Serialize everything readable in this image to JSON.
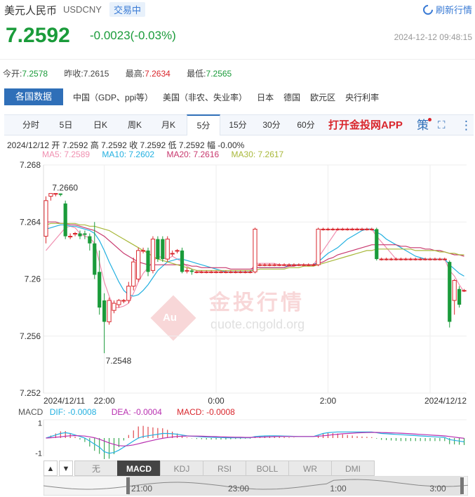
{
  "header": {
    "title": "美元人民币",
    "code": "USDCNY",
    "status": "交易中",
    "refresh": "刷新行情",
    "price": "7.2592",
    "change": "-0.0023(-0.03%)",
    "timestamp": "2024-12-12 09:48:15"
  },
  "stats": {
    "open_label": "今开:",
    "open": "7.2578",
    "prev_label": "昨收:",
    "prev": "7.2615",
    "high_label": "最高:",
    "high": "7.2634",
    "low_label": "最低:",
    "low": "7.2565"
  },
  "nav": {
    "active": "各国数据",
    "items": [
      "中国（GDP、ppi等）",
      "美国（非农、失业率）",
      "日本",
      "德国",
      "欧元区",
      "央行利率"
    ]
  },
  "tabs": [
    "分时",
    "5日",
    "日K",
    "周K",
    "月K",
    "5分",
    "15分",
    "30分",
    "60分"
  ],
  "selected_tab": "5分",
  "app_label": "打开金投网APP",
  "strategy_label": "策",
  "info": {
    "date": "2024/12/12",
    "open": "开 7.2592",
    "high": "高 7.2592",
    "close": "收 7.2592",
    "low": "低 7.2592",
    "amp": "幅 -0.00%"
  },
  "ma": {
    "ma5": "MA5: 7.2589",
    "ma10": "MA10: 7.2602",
    "ma20": "MA20: 7.2616",
    "ma30": "MA30: 7.2617"
  },
  "macd_info": {
    "label": "MACD",
    "dif": "DIF: -0.0008",
    "dea": "DEA: -0.0004",
    "macd": "MACD: -0.0008"
  },
  "watermark": {
    "brand": "金投行情",
    "url": "quote.cngold.org",
    "badge": "Au"
  },
  "bottom_tabs": [
    "无",
    "MACD",
    "KDJ",
    "RSI",
    "BOLL",
    "WR",
    "DMI"
  ],
  "bottom_selected": "MACD",
  "arrows": {
    "up": "▲",
    "down": "▼"
  },
  "colors": {
    "up": "#d9262c",
    "down": "#1a9b3a",
    "ma5": "#f08fb0",
    "ma10": "#22b0e0",
    "ma20": "#c8386e",
    "ma30": "#a8b83a",
    "dif": "#22b0e0",
    "dea": "#b82fb0",
    "accent": "#2f6fb8"
  },
  "chart_data": {
    "type": "candlestick",
    "ylim": [
      7.252,
      7.268
    ],
    "yticks": [
      "7.268",
      "7.264",
      "7.26",
      "7.256",
      "7.252"
    ],
    "x_labels": [
      "2024/12/11",
      "22:00",
      "0:00",
      "2:00",
      "2024/12/12"
    ],
    "annotations": {
      "max": "7.2660",
      "min": "7.2548"
    },
    "candles": [
      {
        "o": 7.263,
        "c": 7.2655,
        "h": 7.2658,
        "l": 7.2625
      },
      {
        "o": 7.2658,
        "c": 7.266,
        "h": 7.266,
        "l": 7.2655
      },
      {
        "o": 7.266,
        "c": 7.266,
        "h": 7.266,
        "l": 7.2658
      },
      {
        "o": 7.266,
        "c": 7.2659,
        "h": 7.266,
        "l": 7.2658
      },
      {
        "o": 7.2653,
        "c": 7.263,
        "h": 7.2655,
        "l": 7.2628
      },
      {
        "o": 7.263,
        "c": 7.263,
        "h": 7.2632,
        "l": 7.2628
      },
      {
        "o": 7.2632,
        "c": 7.2632,
        "h": 7.2633,
        "l": 7.263
      },
      {
        "o": 7.2632,
        "c": 7.263,
        "h": 7.2634,
        "l": 7.2628
      },
      {
        "o": 7.2632,
        "c": 7.2631,
        "h": 7.2634,
        "l": 7.2628
      },
      {
        "o": 7.263,
        "c": 7.2625,
        "h": 7.2632,
        "l": 7.262
      },
      {
        "o": 7.2625,
        "c": 7.2603,
        "h": 7.264,
        "l": 7.26
      },
      {
        "o": 7.2605,
        "c": 7.258,
        "h": 7.262,
        "l": 7.2575
      },
      {
        "o": 7.2585,
        "c": 7.257,
        "h": 7.259,
        "l": 7.2548
      },
      {
        "o": 7.257,
        "c": 7.2585,
        "h": 7.2587,
        "l": 7.2568
      },
      {
        "o": 7.2578,
        "c": 7.2583,
        "h": 7.2585,
        "l": 7.2576
      },
      {
        "o": 7.2582,
        "c": 7.2585,
        "h": 7.2586,
        "l": 7.258
      },
      {
        "o": 7.2585,
        "c": 7.2585,
        "h": 7.2586,
        "l": 7.2583
      },
      {
        "o": 7.2585,
        "c": 7.2595,
        "h": 7.2598,
        "l": 7.2583
      },
      {
        "o": 7.2595,
        "c": 7.2612,
        "h": 7.2615,
        "l": 7.2592
      },
      {
        "o": 7.26,
        "c": 7.262,
        "h": 7.2622,
        "l": 7.2598
      },
      {
        "o": 7.262,
        "c": 7.262,
        "h": 7.2622,
        "l": 7.2618
      },
      {
        "o": 7.262,
        "c": 7.2605,
        "h": 7.2622,
        "l": 7.2602
      },
      {
        "o": 7.2606,
        "c": 7.2628,
        "h": 7.263,
        "l": 7.2604
      },
      {
        "o": 7.2628,
        "c": 7.2614,
        "h": 7.263,
        "l": 7.2612
      },
      {
        "o": 7.2628,
        "c": 7.2614,
        "h": 7.263,
        "l": 7.2612
      },
      {
        "o": 7.2614,
        "c": 7.2628,
        "h": 7.263,
        "l": 7.2612
      },
      {
        "o": 7.2618,
        "c": 7.2618,
        "h": 7.262,
        "l": 7.2616
      },
      {
        "o": 7.262,
        "c": 7.262,
        "h": 7.2621,
        "l": 7.2618
      },
      {
        "o": 7.262,
        "c": 7.2605,
        "h": 7.2622,
        "l": 7.2604
      },
      {
        "o": 7.2606,
        "c": 7.2606,
        "h": 7.2608,
        "l": 7.2604
      },
      {
        "o": 7.2606,
        "c": 7.2605,
        "h": 7.2607,
        "l": 7.2603
      },
      {
        "o": 7.2605,
        "c": 7.2605,
        "h": 7.2606,
        "l": 7.2604
      },
      {
        "o": 7.2605,
        "c": 7.2605,
        "h": 7.2606,
        "l": 7.2604
      },
      {
        "o": 7.2605,
        "c": 7.2605,
        "h": 7.2606,
        "l": 7.2604
      },
      {
        "o": 7.2605,
        "c": 7.2605,
        "h": 7.2606,
        "l": 7.2604
      },
      {
        "o": 7.2605,
        "c": 7.2605,
        "h": 7.2606,
        "l": 7.2604
      },
      {
        "o": 7.2605,
        "c": 7.2605,
        "h": 7.2606,
        "l": 7.2604
      },
      {
        "o": 7.2605,
        "c": 7.2605,
        "h": 7.2606,
        "l": 7.2604
      },
      {
        "o": 7.2605,
        "c": 7.2605,
        "h": 7.2606,
        "l": 7.2604
      },
      {
        "o": 7.2605,
        "c": 7.2605,
        "h": 7.2606,
        "l": 7.2604
      },
      {
        "o": 7.2605,
        "c": 7.2605,
        "h": 7.2606,
        "l": 7.2604
      },
      {
        "o": 7.2605,
        "c": 7.2605,
        "h": 7.2606,
        "l": 7.2604
      },
      {
        "o": 7.2605,
        "c": 7.2605,
        "h": 7.2606,
        "l": 7.2604
      },
      {
        "o": 7.2605,
        "c": 7.2635,
        "h": 7.2636,
        "l": 7.2604
      },
      {
        "o": 7.261,
        "c": 7.261,
        "h": 7.2611,
        "l": 7.2609
      },
      {
        "o": 7.261,
        "c": 7.261,
        "h": 7.2611,
        "l": 7.2609
      },
      {
        "o": 7.261,
        "c": 7.261,
        "h": 7.2611,
        "l": 7.2609
      },
      {
        "o": 7.261,
        "c": 7.261,
        "h": 7.2611,
        "l": 7.2609
      },
      {
        "o": 7.261,
        "c": 7.261,
        "h": 7.2611,
        "l": 7.2609
      },
      {
        "o": 7.261,
        "c": 7.261,
        "h": 7.2611,
        "l": 7.2609
      },
      {
        "o": 7.261,
        "c": 7.261,
        "h": 7.2611,
        "l": 7.2609
      },
      {
        "o": 7.261,
        "c": 7.261,
        "h": 7.2611,
        "l": 7.2609
      },
      {
        "o": 7.261,
        "c": 7.261,
        "h": 7.2611,
        "l": 7.2609
      },
      {
        "o": 7.261,
        "c": 7.261,
        "h": 7.2611,
        "l": 7.2609
      },
      {
        "o": 7.261,
        "c": 7.261,
        "h": 7.2611,
        "l": 7.2609
      },
      {
        "o": 7.261,
        "c": 7.261,
        "h": 7.2611,
        "l": 7.2609
      },
      {
        "o": 7.261,
        "c": 7.2635,
        "h": 7.2636,
        "l": 7.2609
      },
      {
        "o": 7.2635,
        "c": 7.2635,
        "h": 7.2636,
        "l": 7.2634
      },
      {
        "o": 7.2635,
        "c": 7.2635,
        "h": 7.2636,
        "l": 7.2634
      },
      {
        "o": 7.2635,
        "c": 7.2635,
        "h": 7.2636,
        "l": 7.2634
      },
      {
        "o": 7.2635,
        "c": 7.2635,
        "h": 7.2636,
        "l": 7.2634
      },
      {
        "o": 7.2635,
        "c": 7.2635,
        "h": 7.2636,
        "l": 7.2634
      },
      {
        "o": 7.2635,
        "c": 7.2635,
        "h": 7.2636,
        "l": 7.2634
      },
      {
        "o": 7.2635,
        "c": 7.2635,
        "h": 7.2636,
        "l": 7.2634
      },
      {
        "o": 7.2635,
        "c": 7.2635,
        "h": 7.2636,
        "l": 7.2634
      },
      {
        "o": 7.2635,
        "c": 7.2635,
        "h": 7.2636,
        "l": 7.2634
      },
      {
        "o": 7.2635,
        "c": 7.2635,
        "h": 7.2636,
        "l": 7.2634
      },
      {
        "o": 7.2635,
        "c": 7.2635,
        "h": 7.2636,
        "l": 7.2634
      },
      {
        "o": 7.2635,
        "c": 7.2614,
        "h": 7.2636,
        "l": 7.2613
      },
      {
        "o": 7.2614,
        "c": 7.2614,
        "h": 7.2615,
        "l": 7.2613
      },
      {
        "o": 7.2614,
        "c": 7.2614,
        "h": 7.2615,
        "l": 7.2613
      },
      {
        "o": 7.2614,
        "c": 7.2614,
        "h": 7.2615,
        "l": 7.2613
      },
      {
        "o": 7.2614,
        "c": 7.2614,
        "h": 7.2615,
        "l": 7.2613
      },
      {
        "o": 7.2614,
        "c": 7.2614,
        "h": 7.2615,
        "l": 7.2613
      },
      {
        "o": 7.2614,
        "c": 7.2614,
        "h": 7.2615,
        "l": 7.2613
      },
      {
        "o": 7.2614,
        "c": 7.2614,
        "h": 7.2615,
        "l": 7.2613
      },
      {
        "o": 7.2614,
        "c": 7.2614,
        "h": 7.2615,
        "l": 7.2613
      },
      {
        "o": 7.2614,
        "c": 7.2614,
        "h": 7.2615,
        "l": 7.2613
      },
      {
        "o": 7.2614,
        "c": 7.2614,
        "h": 7.2615,
        "l": 7.2613
      },
      {
        "o": 7.2614,
        "c": 7.2614,
        "h": 7.2615,
        "l": 7.2613
      },
      {
        "o": 7.2614,
        "c": 7.2614,
        "h": 7.2615,
        "l": 7.2613
      },
      {
        "o": 7.2614,
        "c": 7.2614,
        "h": 7.2615,
        "l": 7.2613
      },
      {
        "o": 7.2614,
        "c": 7.2614,
        "h": 7.2615,
        "l": 7.2613
      },
      {
        "o": 7.2612,
        "c": 7.257,
        "h": 7.2613,
        "l": 7.2566
      },
      {
        "o": 7.2585,
        "c": 7.2599,
        "h": 7.26,
        "l": 7.2575
      },
      {
        "o": 7.2593,
        "c": 7.2582,
        "h": 7.2595,
        "l": 7.258
      },
      {
        "o": 7.2592,
        "c": 7.2592,
        "h": 7.2593,
        "l": 7.2591
      }
    ],
    "ma_series": [
      {
        "name": "MA5",
        "values": [
          7.262,
          7.2624,
          7.2628,
          7.2632,
          7.2636,
          7.2637,
          7.2636,
          7.2632,
          7.263,
          7.2629,
          7.2625,
          7.2612,
          7.2598,
          7.2588,
          7.258,
          7.258,
          7.2581,
          7.2583,
          7.259,
          7.2598,
          7.2604,
          7.2608,
          7.2612,
          7.2616,
          7.2615,
          7.2614,
          7.2616,
          7.2614,
          7.2612,
          7.2609,
          7.2607,
          7.2606,
          7.2605,
          7.2605,
          7.2605,
          7.2605,
          7.2605,
          7.2605,
          7.2605,
          7.2605,
          7.2605,
          7.2605,
          7.2605,
          7.2611,
          7.2611,
          7.2611,
          7.2611,
          7.2611,
          7.261,
          7.261,
          7.261,
          7.261,
          7.261,
          7.261,
          7.261,
          7.261,
          7.2615,
          7.262,
          7.2625,
          7.263,
          7.2635,
          7.2635,
          7.2635,
          7.2635,
          7.2635,
          7.2635,
          7.2635,
          7.2635,
          7.263,
          7.2626,
          7.2622,
          7.2618,
          7.2614,
          7.2614,
          7.2614,
          7.2614,
          7.2614,
          7.2614,
          7.2614,
          7.2614,
          7.2614,
          7.2614,
          7.2614,
          7.2606,
          7.2602,
          7.2596,
          7.2591
        ]
      },
      {
        "name": "MA10",
        "values": [
          7.2635,
          7.2636,
          7.2637,
          7.2638,
          7.2638,
          7.2637,
          7.2637,
          7.2636,
          7.2635,
          7.2634,
          7.2632,
          7.2627,
          7.262,
          7.2612,
          7.2605,
          7.2598,
          7.2592,
          7.2589,
          7.2588,
          7.2589,
          7.2592,
          7.2596,
          7.2601,
          7.2606,
          7.2609,
          7.2612,
          7.2613,
          7.2614,
          7.2614,
          7.2613,
          7.2612,
          7.2611,
          7.261,
          7.2609,
          7.2608,
          7.2607,
          7.2606,
          7.2605,
          7.2605,
          7.2605,
          7.2605,
          7.2605,
          7.2605,
          7.2608,
          7.2608,
          7.2608,
          7.2608,
          7.2608,
          7.2608,
          7.2608,
          7.261,
          7.261,
          7.261,
          7.261,
          7.261,
          7.261,
          7.2612,
          7.2615,
          7.2618,
          7.262,
          7.2622,
          7.2625,
          7.2628,
          7.263,
          7.2632,
          7.2634,
          7.2635,
          7.2635,
          7.2633,
          7.2631,
          7.2628,
          7.2626,
          7.2624,
          7.2622,
          7.262,
          7.2618,
          7.2616,
          7.2615,
          7.2614,
          7.2614,
          7.2614,
          7.2614,
          7.2614,
          7.261,
          7.2607,
          7.2604,
          7.2602
        ]
      },
      {
        "name": "MA20",
        "values": [
          7.264,
          7.264,
          7.264,
          7.2639,
          7.2639,
          7.2638,
          7.2638,
          7.2637,
          7.2636,
          7.2635,
          7.2634,
          7.2632,
          7.263,
          7.2627,
          7.2624,
          7.2621,
          7.2618,
          7.2616,
          7.2614,
          7.2612,
          7.2611,
          7.261,
          7.261,
          7.261,
          7.261,
          7.261,
          7.261,
          7.261,
          7.261,
          7.261,
          7.2609,
          7.2609,
          7.2608,
          7.2608,
          7.2608,
          7.2608,
          7.2608,
          7.2608,
          7.2607,
          7.2607,
          7.2607,
          7.2607,
          7.2607,
          7.2608,
          7.2608,
          7.2608,
          7.2608,
          7.2608,
          7.2608,
          7.2608,
          7.2609,
          7.2609,
          7.261,
          7.261,
          7.261,
          7.261,
          7.2611,
          7.2612,
          7.2614,
          7.2615,
          7.2617,
          7.2618,
          7.2619,
          7.262,
          7.2621,
          7.2622,
          7.2623,
          7.2624,
          7.2624,
          7.2624,
          7.2624,
          7.2624,
          7.2624,
          7.2623,
          7.2623,
          7.2622,
          7.2622,
          7.2622,
          7.2621,
          7.2621,
          7.262,
          7.262,
          7.2619,
          7.2618,
          7.2617,
          7.2617,
          7.2616
        ]
      },
      {
        "name": "MA30",
        "values": [
          7.2638,
          7.2639,
          7.2639,
          7.2639,
          7.2639,
          7.2639,
          7.2639,
          7.2638,
          7.2638,
          7.2637,
          7.2637,
          7.2636,
          7.2635,
          7.2634,
          7.2632,
          7.263,
          7.2628,
          7.2626,
          7.2624,
          7.2622,
          7.262,
          7.2618,
          7.2616,
          7.2614,
          7.2613,
          7.2612,
          7.2611,
          7.261,
          7.2609,
          7.2608,
          7.2607,
          7.2606,
          7.2606,
          7.2606,
          7.2606,
          7.2606,
          7.2606,
          7.2606,
          7.2606,
          7.2606,
          7.2606,
          7.2606,
          7.2606,
          7.2606,
          7.2607,
          7.2607,
          7.2607,
          7.2607,
          7.2607,
          7.2607,
          7.2608,
          7.2608,
          7.2608,
          7.2609,
          7.2609,
          7.2609,
          7.261,
          7.2611,
          7.2612,
          7.2613,
          7.2614,
          7.2615,
          7.2616,
          7.2617,
          7.2618,
          7.2619,
          7.262,
          7.262,
          7.2621,
          7.2621,
          7.2621,
          7.2621,
          7.2621,
          7.2621,
          7.2621,
          7.2621,
          7.262,
          7.262,
          7.262,
          7.262,
          7.262,
          7.2619,
          7.2619,
          7.2618,
          7.2618,
          7.2617,
          7.2617
        ]
      }
    ],
    "macd": {
      "ylim": [
        -1.2,
        1.2
      ],
      "yticks": [
        "1",
        "-1"
      ],
      "dif": [
        0.0,
        0.1,
        0.2,
        0.3,
        0.35,
        0.3,
        0.2,
        0.1,
        0.0,
        -0.2,
        -0.4,
        -0.6,
        -0.9,
        -1.0,
        -0.95,
        -0.8,
        -0.6,
        -0.4,
        -0.2,
        0.0,
        0.1,
        0.15,
        0.2,
        0.25,
        0.3,
        0.3,
        0.28,
        0.25,
        0.2,
        0.15,
        0.12,
        0.1,
        0.08,
        0.06,
        0.05,
        0.04,
        0.03,
        0.02,
        0.02,
        0.02,
        0.02,
        0.02,
        0.02,
        0.1,
        0.12,
        0.14,
        0.15,
        0.15,
        0.14,
        0.13,
        0.12,
        0.11,
        0.1,
        0.1,
        0.1,
        0.1,
        0.2,
        0.3,
        0.35,
        0.38,
        0.4,
        0.4,
        0.4,
        0.4,
        0.4,
        0.4,
        0.4,
        0.4,
        0.35,
        0.3,
        0.28,
        0.26,
        0.24,
        0.22,
        0.2,
        0.18,
        0.16,
        0.14,
        0.12,
        0.1,
        0.08,
        0.06,
        0.04,
        -0.1,
        -0.15,
        -0.2,
        -0.25
      ],
      "dea": [
        0.0,
        0.02,
        0.05,
        0.08,
        0.12,
        0.15,
        0.16,
        0.15,
        0.13,
        0.08,
        0.02,
        -0.08,
        -0.2,
        -0.32,
        -0.42,
        -0.5,
        -0.52,
        -0.5,
        -0.45,
        -0.38,
        -0.3,
        -0.22,
        -0.15,
        -0.08,
        -0.02,
        0.03,
        0.07,
        0.1,
        0.12,
        0.13,
        0.13,
        0.13,
        0.12,
        0.11,
        0.1,
        0.09,
        0.08,
        0.07,
        0.06,
        0.05,
        0.05,
        0.04,
        0.04,
        0.05,
        0.06,
        0.07,
        0.08,
        0.09,
        0.1,
        0.1,
        0.1,
        0.1,
        0.1,
        0.1,
        0.1,
        0.1,
        0.12,
        0.15,
        0.18,
        0.22,
        0.25,
        0.28,
        0.3,
        0.32,
        0.34,
        0.35,
        0.36,
        0.37,
        0.37,
        0.36,
        0.35,
        0.34,
        0.33,
        0.32,
        0.3,
        0.28,
        0.26,
        0.24,
        0.22,
        0.2,
        0.18,
        0.16,
        0.14,
        0.1,
        0.06,
        0.02,
        -0.02
      ]
    },
    "nav_labels": [
      "21:00",
      "23:00",
      "1:00",
      "3:00"
    ]
  }
}
